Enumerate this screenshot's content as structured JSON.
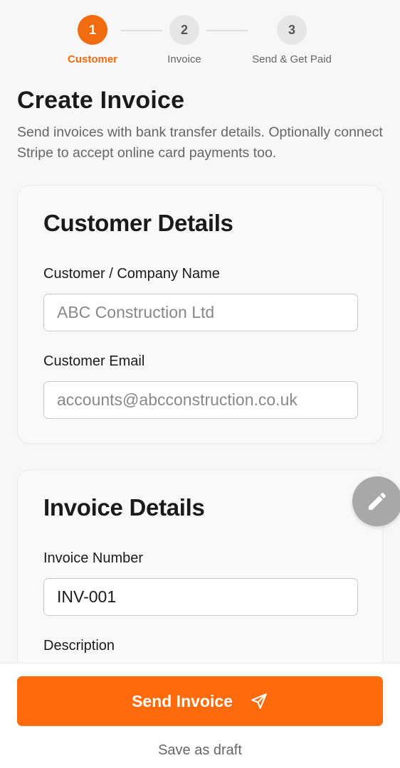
{
  "stepper": {
    "steps": [
      {
        "number": "1",
        "label": "Customer",
        "active": true
      },
      {
        "number": "2",
        "label": "Invoice",
        "active": false
      },
      {
        "number": "3",
        "label": "Send & Get Paid",
        "active": false
      }
    ]
  },
  "header": {
    "title": "Create Invoice",
    "subtitle": "Send invoices with bank transfer details. Optionally connect Stripe to accept online card payments too."
  },
  "customer_details": {
    "title": "Customer Details",
    "name_label": "Customer / Company Name",
    "name_placeholder": "ABC Construction Ltd",
    "email_label": "Customer Email",
    "email_placeholder": "accounts@abcconstruction.co.uk"
  },
  "invoice_details": {
    "title": "Invoice Details",
    "number_label": "Invoice Number",
    "number_value": "INV-001",
    "description_label": "Description"
  },
  "actions": {
    "send_label": "Send Invoice",
    "draft_label": "Save as draft"
  },
  "icons": {
    "edit": "pencil-icon",
    "send": "paper-plane-icon"
  },
  "colors": {
    "accent": "#ff6a0a",
    "step_active": "#f26b0f",
    "fab": "#a8a8a8"
  }
}
